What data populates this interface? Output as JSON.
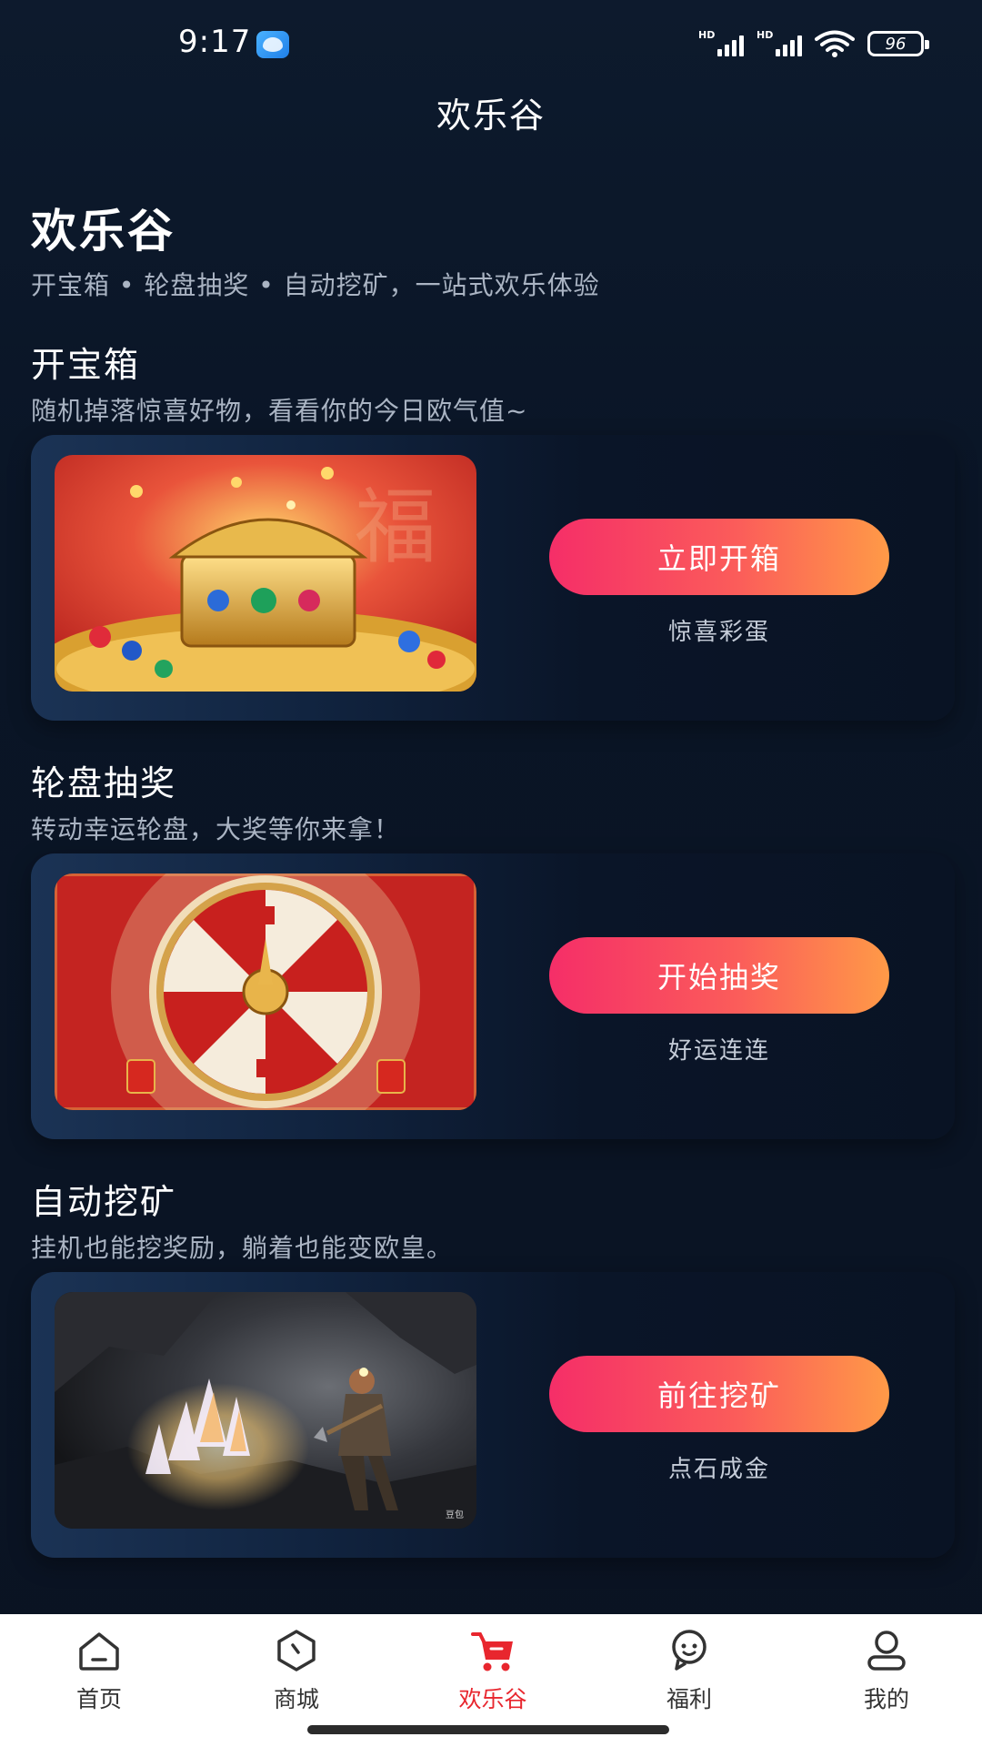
{
  "status_bar": {
    "time": "9:17",
    "battery": "96",
    "signal_label_1": "HD",
    "signal_label_2": "HD"
  },
  "header": {
    "title": "欢乐谷"
  },
  "hero": {
    "title": "欢乐谷",
    "subtitle": "开宝箱 • 轮盘抽奖 • 自动挖矿，一站式欢乐体验"
  },
  "sections": [
    {
      "title": "开宝箱",
      "description": "随机掉落惊喜好物，看看你的今日欧气值~",
      "button": "立即开箱",
      "tag": "惊喜彩蛋",
      "image_icon": "treasure-chest"
    },
    {
      "title": "轮盘抽奖",
      "description": "转动幸运轮盘，大奖等你来拿！",
      "button": "开始抽奖",
      "tag": "好运连连",
      "image_icon": "lucky-wheel"
    },
    {
      "title": "自动挖矿",
      "description": "挂机也能挖奖励，躺着也能变欧皇。",
      "button": "前往挖矿",
      "tag": "点石成金",
      "image_icon": "mining-cave"
    }
  ],
  "bottom_nav": {
    "items": [
      {
        "label": "首页",
        "icon": "home-icon"
      },
      {
        "label": "商城",
        "icon": "shop-icon"
      },
      {
        "label": "欢乐谷",
        "icon": "cart-icon",
        "active": true
      },
      {
        "label": "福利",
        "icon": "welfare-icon"
      },
      {
        "label": "我的",
        "icon": "profile-icon"
      }
    ]
  },
  "colors": {
    "accent": "#e8262e",
    "button_start": "#f52e68",
    "button_end": "#ff9a47",
    "background": "#0a1526"
  }
}
